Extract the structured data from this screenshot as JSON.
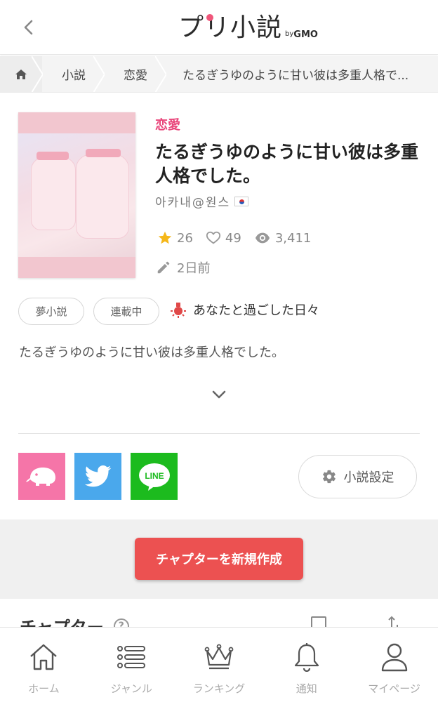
{
  "header": {
    "logo_main": "プリ小説",
    "logo_by": "by",
    "logo_gmo": "GMO"
  },
  "breadcrumb": {
    "items": [
      "小説",
      "恋愛"
    ],
    "current": "たるぎうゆのように甘い彼は多重人格で..."
  },
  "novel": {
    "genre": "恋愛",
    "title": "たるぎうゆのように甘い彼は多重人格でした。",
    "author": "아카내@원스",
    "stats": {
      "stars": "26",
      "likes": "49",
      "views": "3,411"
    },
    "updated": "2日前",
    "tags": [
      "夢小説",
      "連載中"
    ],
    "event": "あなたと過ごした日々",
    "summary": "たるぎうゆのように甘い彼は多重人格でした。"
  },
  "share": {
    "line_label": "LINE",
    "settings_label": "小説設定"
  },
  "actions": {
    "create_chapter": "チャプターを新規作成"
  },
  "chapter_section": {
    "heading": "チャプター",
    "help": "?"
  },
  "bottom_nav": {
    "items": [
      {
        "label": "ホーム",
        "icon": "home-icon"
      },
      {
        "label": "ジャンル",
        "icon": "list-icon"
      },
      {
        "label": "ランキング",
        "icon": "crown-icon"
      },
      {
        "label": "通知",
        "icon": "bell-icon"
      },
      {
        "label": "マイページ",
        "icon": "user-icon"
      }
    ]
  },
  "colors": {
    "accent_pink": "#e9467b",
    "create_button": "#ec5151",
    "twitter": "#4aa8ec",
    "line": "#1cbb1e",
    "elephant": "#f575a8"
  }
}
